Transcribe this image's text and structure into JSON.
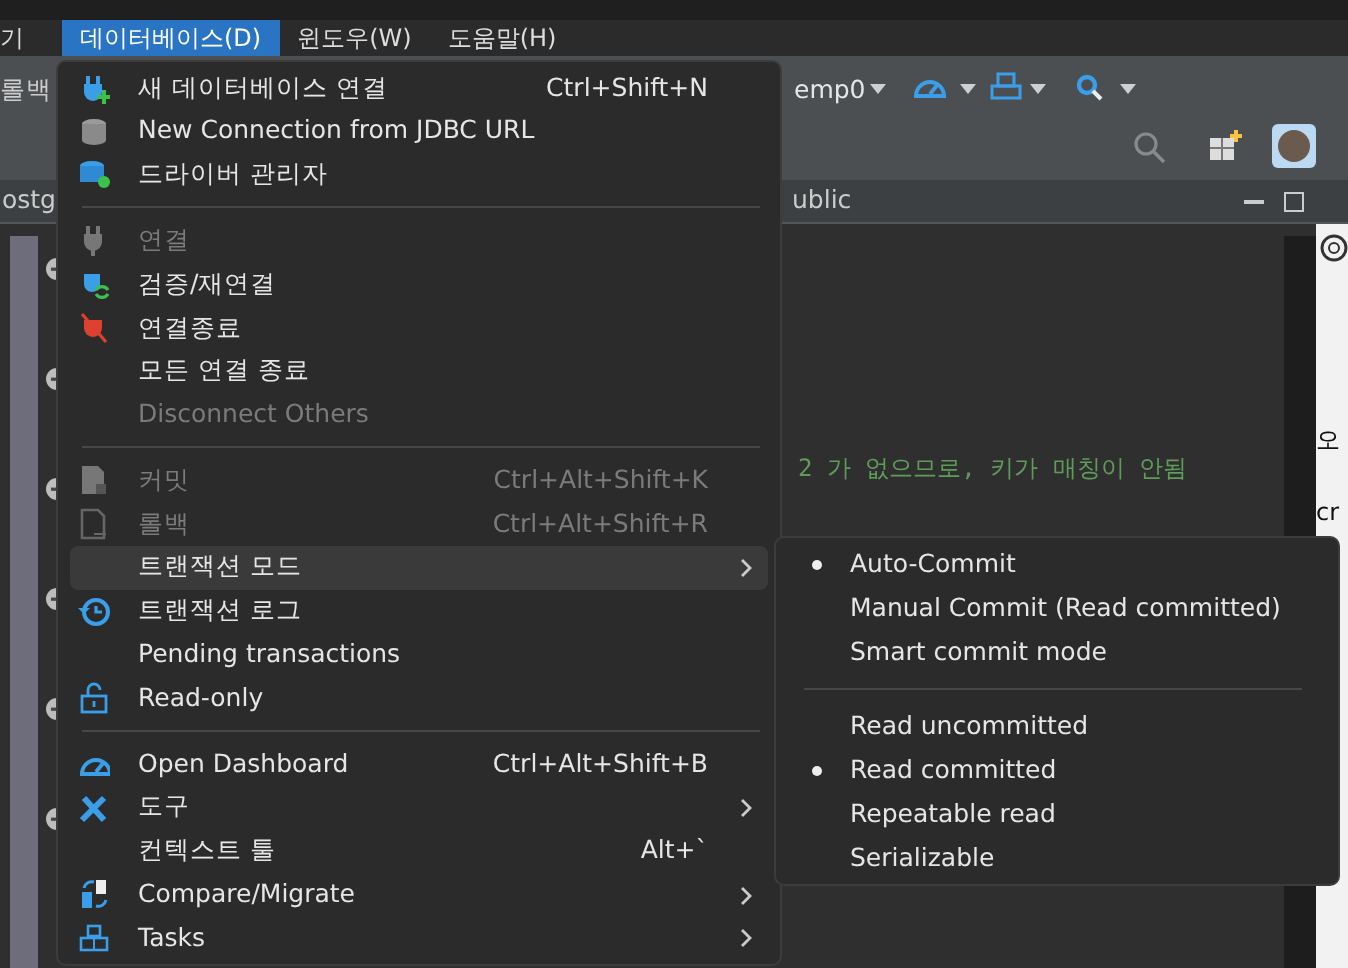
{
  "menubar": [
    {
      "label": "기",
      "selected": false
    },
    {
      "label": "데이터베이스(D)",
      "selected": true
    },
    {
      "label": "윈도우(W)",
      "selected": false
    },
    {
      "label": "도움말(H)",
      "selected": false
    }
  ],
  "toolbar": {
    "left_text": "롤백",
    "connection_text": "emp0"
  },
  "tabs": [
    {
      "label": "ostg"
    },
    {
      "label": "ublic"
    }
  ],
  "editor": {
    "comment": "2 가 없으므로, 키가 매칭이 안됨"
  },
  "side_panel": {
    "texts": [
      "오",
      "cr"
    ]
  },
  "menu": {
    "sections": [
      [
        {
          "label": "새 데이터베이스 연결",
          "shortcut": "Ctrl+Shift+N",
          "disabled": false,
          "selected": false,
          "submenu": false
        },
        {
          "label": "New Connection from JDBC URL",
          "disabled": false,
          "selected": false,
          "submenu": false
        },
        {
          "label": "드라이버 관리자",
          "disabled": false,
          "selected": false,
          "submenu": false
        }
      ],
      [
        {
          "label": "연결",
          "disabled": true,
          "selected": false,
          "submenu": false
        },
        {
          "label": "검증/재연결",
          "disabled": false,
          "selected": false,
          "submenu": false
        },
        {
          "label": "연결종료",
          "disabled": false,
          "selected": false,
          "submenu": false
        },
        {
          "label": "모든 연결 종료",
          "disabled": false,
          "selected": false,
          "submenu": false
        },
        {
          "label": "Disconnect Others",
          "disabled": true,
          "selected": false,
          "submenu": false
        }
      ],
      [
        {
          "label": "커밋",
          "shortcut": "Ctrl+Alt+Shift+K",
          "disabled": true,
          "selected": false,
          "submenu": false
        },
        {
          "label": "롤백",
          "shortcut": "Ctrl+Alt+Shift+R",
          "disabled": true,
          "selected": false,
          "submenu": false
        },
        {
          "label": "트랜잭션 모드",
          "disabled": false,
          "selected": true,
          "submenu": true
        },
        {
          "label": "트랜잭션 로그",
          "disabled": false,
          "selected": false,
          "submenu": false
        },
        {
          "label": "Pending transactions",
          "disabled": false,
          "selected": false,
          "submenu": false
        },
        {
          "label": "Read-only",
          "disabled": false,
          "selected": false,
          "submenu": false
        }
      ],
      [
        {
          "label": "Open Dashboard",
          "shortcut": "Ctrl+Alt+Shift+B",
          "disabled": false,
          "selected": false,
          "submenu": false
        },
        {
          "label": "도구",
          "disabled": false,
          "selected": false,
          "submenu": true
        },
        {
          "label": "컨텍스트 툴",
          "shortcut": "Alt+`",
          "disabled": false,
          "selected": false,
          "submenu": false
        },
        {
          "label": "Compare/Migrate",
          "disabled": false,
          "selected": false,
          "submenu": true
        },
        {
          "label": "Tasks",
          "disabled": false,
          "selected": false,
          "submenu": true
        }
      ]
    ]
  },
  "submenu": {
    "sections": [
      [
        {
          "label": "Auto-Commit",
          "selected": true
        },
        {
          "label": "Manual Commit (Read committed)",
          "selected": false
        },
        {
          "label": "Smart commit mode",
          "selected": false
        }
      ],
      [
        {
          "label": "Read uncommitted",
          "selected": false
        },
        {
          "label": "Read committed",
          "selected": true
        },
        {
          "label": "Repeatable read",
          "selected": false
        },
        {
          "label": "Serializable",
          "selected": false
        }
      ]
    ]
  }
}
